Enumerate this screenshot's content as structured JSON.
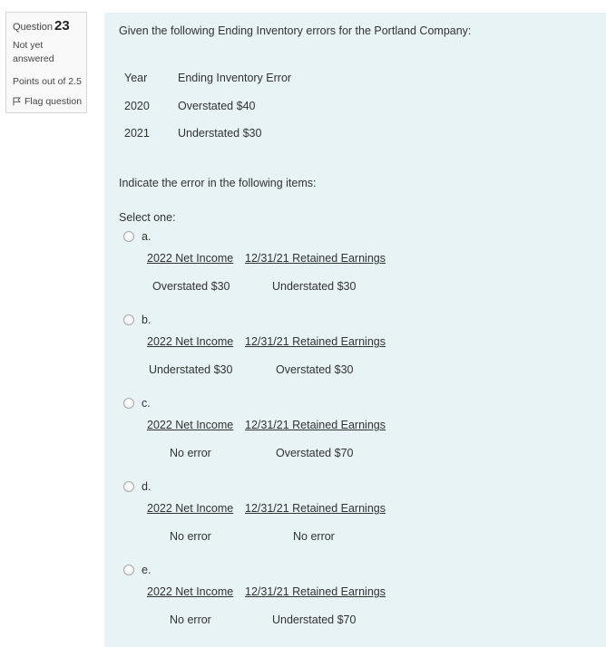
{
  "info": {
    "question_label": "Question",
    "question_number": "23",
    "state_line1": "Not yet",
    "state_line2": "answered",
    "grade": "Points out of 2.5",
    "flag_label": "Flag question"
  },
  "question": {
    "intro": "Given the following Ending Inventory errors for the Portland Company:",
    "table": {
      "headers": [
        "Year",
        "Ending Inventory Error"
      ],
      "rows": [
        [
          "2020",
          "Overstated $40"
        ],
        [
          "2021",
          "Understated $30"
        ]
      ]
    },
    "prompt": "Indicate the error in the following items:",
    "select_label": "Select one:"
  },
  "options": [
    {
      "letter": "a.",
      "col1_header": "2022 Net Income",
      "col2_header": "12/31/21 Retained Earnings",
      "col1_value": "Overstated $30",
      "col2_value": "Understated $30"
    },
    {
      "letter": "b.",
      "col1_header": "2022 Net Income",
      "col2_header": "12/31/21 Retained Earnings",
      "col1_value": "Understated $30",
      "col2_value": "Overstated $30"
    },
    {
      "letter": "c.",
      "col1_header": "2022 Net Income",
      "col2_header": "12/31/21 Retained Earnings",
      "col1_value": "No error",
      "col2_value": "Overstated $70"
    },
    {
      "letter": "d.",
      "col1_header": "2022 Net Income",
      "col2_header": "12/31/21 Retained Earnings",
      "col1_value": "No error",
      "col2_value": "No error"
    },
    {
      "letter": "e.",
      "col1_header": "2022 Net Income",
      "col2_header": "12/31/21 Retained Earnings",
      "col1_value": "No error",
      "col2_value": "Understated $70"
    }
  ]
}
